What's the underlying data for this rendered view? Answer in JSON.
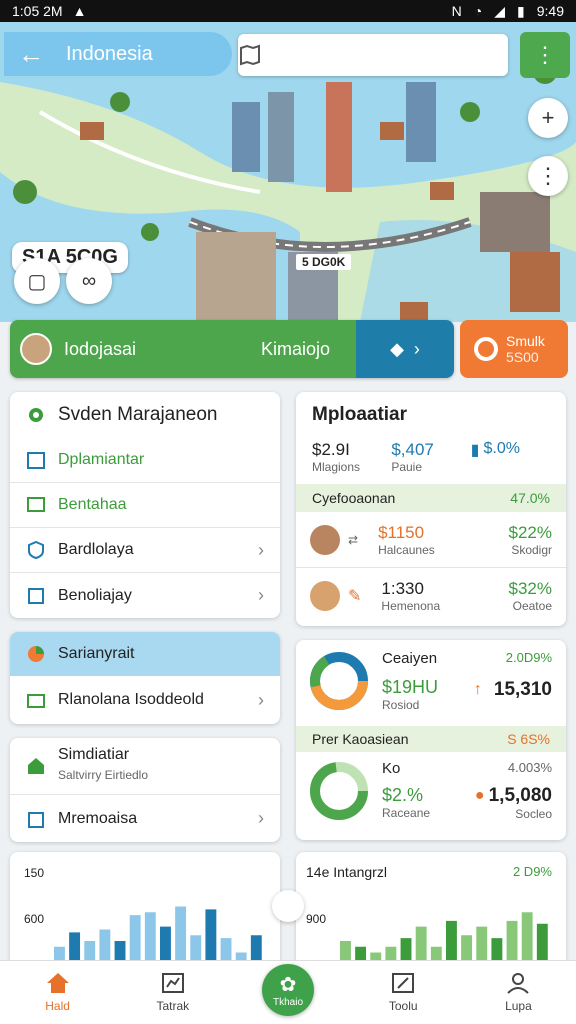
{
  "status": {
    "time": "1:05 2M",
    "right_time": "9:49"
  },
  "header": {
    "title": "Indonesia"
  },
  "map": {
    "label": "S1A 5C0G",
    "road_label": "5 DG0K"
  },
  "banner": {
    "name": "Iodojasai",
    "place": "Kimaiojo",
    "action_label": "◆",
    "chevron": "›"
  },
  "orange_card": {
    "line1": "Smulk",
    "line2": "5S00"
  },
  "system_card": {
    "title": "Svden Marajaneon",
    "items": [
      {
        "label": "Dplamiantar",
        "icon": "calendar-icon"
      },
      {
        "label": "Bentahaa",
        "icon": "chat-icon"
      },
      {
        "label": "Bardlolaya",
        "icon": "shield-icon"
      },
      {
        "label": "Benoliajay",
        "icon": "box-icon"
      }
    ]
  },
  "metrics_card": {
    "title": "Mploaatiar",
    "top": [
      {
        "value": "$2.9I",
        "caption": "Mlagions"
      },
      {
        "value": "$,407",
        "caption": "Pauie"
      },
      {
        "value": "$.0%",
        "caption": ""
      }
    ],
    "band_label": "Cyefooaonan",
    "band_value": "47.0%",
    "rows": [
      {
        "value": "$1150",
        "caption": "Halcaunes",
        "right": "$22%",
        "right_caption": "Skodigr"
      },
      {
        "value": "1:330",
        "caption": "Hemenona",
        "right": "$32%",
        "right_caption": "Oeatoe"
      }
    ]
  },
  "sarianyrait_card": {
    "title": "Sarianyrait",
    "item": "Rlanolana Isoddeold"
  },
  "donut_card": {
    "top": {
      "title": "Ceaiyen",
      "pct": "2.0D9%",
      "value": "$19HU",
      "caption": "Rosiod",
      "right_value": "15,310"
    },
    "band_label": "Prer Kaoasiean",
    "band_value": "S 6S%",
    "bottom": {
      "title": "Ko",
      "pct": "4.003%",
      "value": "$2.%",
      "caption": "Raceane",
      "right_value": "1,5,080",
      "right_caption": "Socleo"
    }
  },
  "simulation_card": {
    "title": "Simdiatiar",
    "subtitle": "Saltvirry Eirtiedlo",
    "item": "Mremoaisa"
  },
  "chart_left": {
    "ytick_top": "150",
    "ytick_mid": "600",
    "title": ""
  },
  "chart_right": {
    "title": "14e Intangrzl",
    "value": "2 D9%",
    "ytick_mid": "900"
  },
  "chart_data": [
    {
      "type": "bar",
      "title": "",
      "ylim": [
        0,
        160
      ],
      "values": [
        30,
        55,
        40,
        60,
        40,
        85,
        90,
        65,
        100,
        50,
        95,
        45,
        20,
        50
      ],
      "colors": [
        "#8cc7ea",
        "#1f7ab0"
      ]
    },
    {
      "type": "bar",
      "title": "14e Intangrzl",
      "ylim": [
        0,
        160
      ],
      "values": [
        40,
        30,
        20,
        30,
        45,
        65,
        30,
        75,
        50,
        65,
        45,
        75,
        90,
        70
      ],
      "colors": [
        "#88c878",
        "#3c9c3c"
      ]
    }
  ],
  "bottomnav": [
    {
      "label": "Hald",
      "icon": "home-icon"
    },
    {
      "label": "Tatrak",
      "icon": "chart-icon"
    },
    {
      "label": "Tkhaio",
      "icon": "globe-icon"
    },
    {
      "label": "Toolu",
      "icon": "edit-icon"
    },
    {
      "label": "Lupa",
      "icon": "profile-icon"
    }
  ],
  "colors": {
    "green": "#4da64b",
    "blue": "#1e7da9",
    "orange": "#f07a33",
    "sky": "#7cc6ee"
  }
}
